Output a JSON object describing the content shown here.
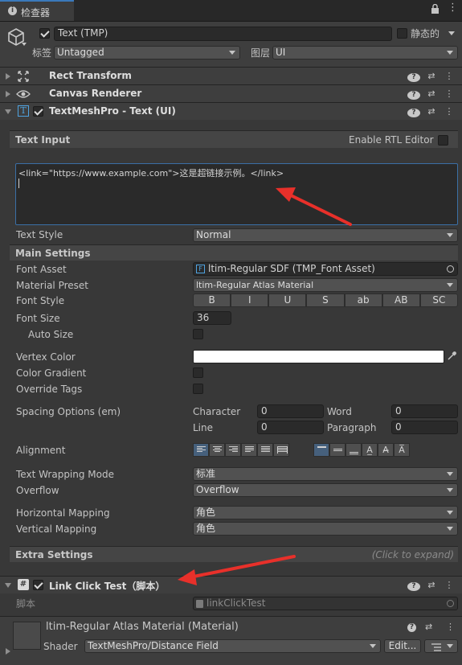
{
  "tab": {
    "label": "检查器"
  },
  "object": {
    "name": "Text (TMP)",
    "static_label": "静态的",
    "tag_label": "标签",
    "tag_value": "Untagged",
    "layer_label": "图层",
    "layer_value": "UI"
  },
  "components": {
    "rect_transform": "Rect Transform",
    "canvas_renderer": "Canvas Renderer",
    "textmeshpro": "TextMeshPro - Text (UI)",
    "link_click": "Link Click Test（脚本）"
  },
  "text_input": {
    "header": "Text Input",
    "rtl_label": "Enable RTL Editor",
    "value": "<link=\"https://www.example.com\">这是超链接示例。</link>",
    "text_style_label": "Text Style",
    "text_style_value": "Normal"
  },
  "main_settings": {
    "header": "Main Settings",
    "font_asset_label": "Font Asset",
    "font_asset_value": "ltim-Regular SDF (TMP_Font Asset)",
    "material_preset_label": "Material Preset",
    "material_preset_value": "ltim-Regular Atlas Material",
    "font_style_label": "Font Style",
    "font_style_buttons": [
      "B",
      "I",
      "U",
      "S",
      "ab",
      "AB",
      "SC"
    ],
    "font_size_label": "Font Size",
    "font_size_value": "36",
    "auto_size_label": "Auto Size",
    "vertex_color_label": "Vertex Color",
    "color_gradient_label": "Color Gradient",
    "override_tags_label": "Override Tags",
    "spacing_label": "Spacing Options (em)",
    "character_label": "Character",
    "character_value": "0",
    "word_label": "Word",
    "word_value": "0",
    "line_label": "Line",
    "line_value": "0",
    "paragraph_label": "Paragraph",
    "paragraph_value": "0",
    "alignment_label": "Alignment",
    "wrapping_label": "Text Wrapping Mode",
    "wrapping_value": "标准",
    "overflow_label": "Overflow",
    "overflow_value": "Overflow",
    "hmap_label": "Horizontal Mapping",
    "hmap_value": "角色",
    "vmap_label": "Vertical Mapping",
    "vmap_value": "角色"
  },
  "extra_settings": {
    "header": "Extra Settings",
    "hint": "(Click to expand)"
  },
  "script": {
    "label": "脚本",
    "value": "linkClickTest"
  },
  "material": {
    "title": "ltim-Regular Atlas Material (Material)",
    "shader_label": "Shader",
    "shader_value": "TextMeshPro/Distance Field",
    "edit_label": "Edit..."
  },
  "colors": {
    "accent_arrow": "#e8302a",
    "selected_align": "#46607c"
  }
}
